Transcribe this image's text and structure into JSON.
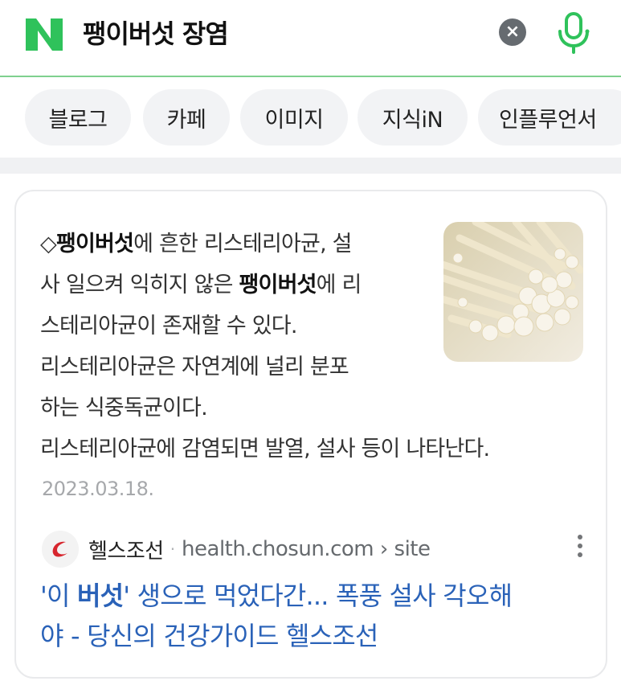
{
  "search": {
    "logo": "N",
    "query": "팽이버섯 장염",
    "clear_icon": "close-icon",
    "mic_icon": "microphone-icon"
  },
  "tabs": [
    {
      "label": "블로그"
    },
    {
      "label": "카페"
    },
    {
      "label": "이미지"
    },
    {
      "label": "지식iN"
    },
    {
      "label": "인플루언서"
    }
  ],
  "result": {
    "snippet": {
      "l1_a": "◇",
      "l1_b": "팽이버섯",
      "l1_c": "에 흔한 리스테리아균, 설",
      "l2_a": "사 일으켜 익히지 않은 ",
      "l2_b": "팽이버섯",
      "l2_c": "에 리",
      "l3": "스테리아균이 존재할 수 있다.",
      "l4": "리스테리아균은 자연계에 널리 분포",
      "l5": "하는 식중독균이다.",
      "l6": "리스테리아균에 감염되면 발열, 설사 등이 나타난다."
    },
    "thumbnail": "enoki-mushroom-photo",
    "date": "2023.03.18.",
    "source": {
      "name": "헬스조선",
      "separator": "·",
      "url": "health.chosun.com › site",
      "favicon_icon": "health-chosun-logo-icon",
      "more_icon": "more-vertical-icon"
    },
    "title": {
      "l1_a": "'이 ",
      "l1_b": "버섯",
      "l1_c": "' 생으로 먹었다간... 폭풍 설사 각오해",
      "l2": "야 - 당신의 건강가이드 헬스조선"
    }
  },
  "colors": {
    "brand_green": "#03c75a",
    "divider_green": "#7fd08e",
    "link_blue": "#2a62b8",
    "date_gray": "#a6a8ab"
  }
}
